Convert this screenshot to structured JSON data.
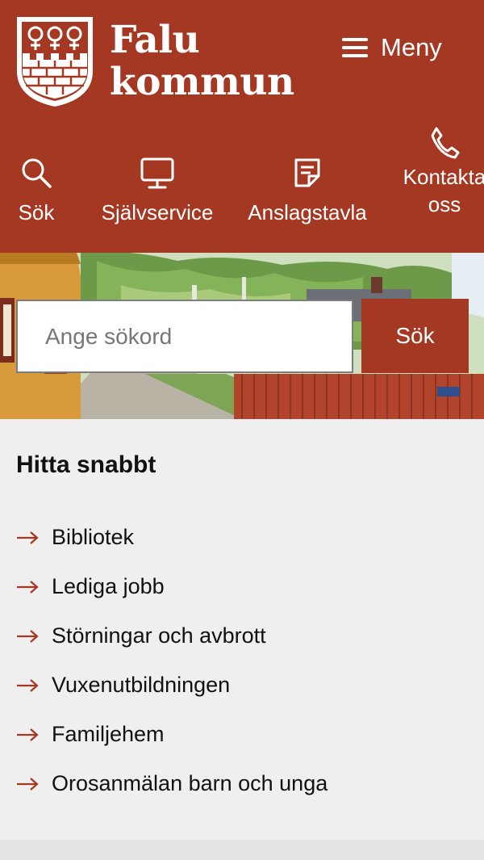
{
  "header": {
    "logo_line1": "Falu",
    "logo_line2": "kommun",
    "menu_label": "Meny",
    "quick_nav": [
      {
        "label": "Sök",
        "icon": "search-icon"
      },
      {
        "label": "Självservice",
        "icon": "monitor-icon"
      },
      {
        "label": "Anslagstavla",
        "icon": "notice-icon"
      },
      {
        "label_line1": "Kontakta",
        "label_line2": "oss",
        "icon": "phone-icon"
      }
    ]
  },
  "search": {
    "placeholder": "Ange sökord",
    "button_label": "Sök"
  },
  "quick_links": {
    "title": "Hitta snabbt",
    "items": [
      {
        "label": "Bibliotek"
      },
      {
        "label": "Lediga jobb"
      },
      {
        "label": "Störningar och avbrott"
      },
      {
        "label": "Vuxenutbildningen"
      },
      {
        "label": "Familjehem"
      },
      {
        "label": "Orosanmälan barn och unga"
      }
    ]
  },
  "colors": {
    "brand": "#a53822",
    "background": "#efefef",
    "text": "#111111"
  }
}
